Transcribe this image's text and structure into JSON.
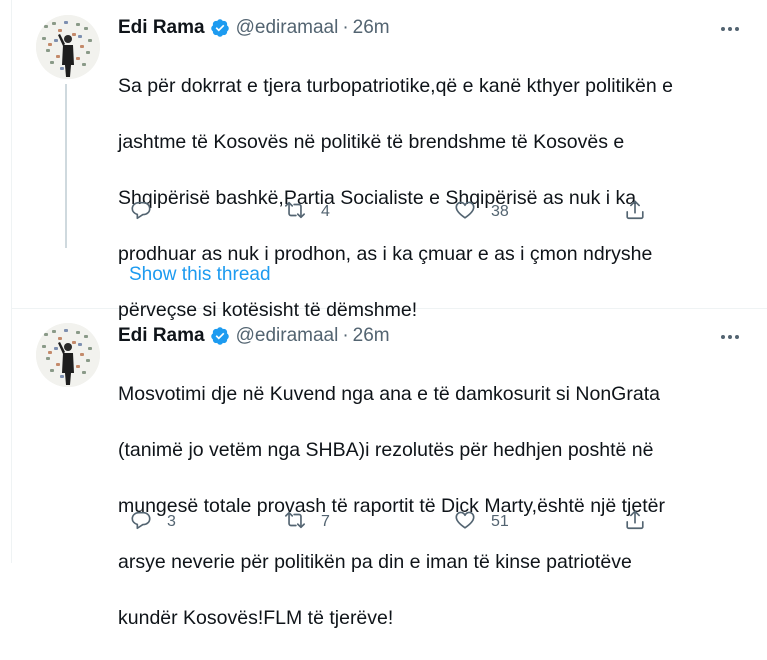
{
  "colors": {
    "accent": "#1d9bf0",
    "secondary_text": "#536471",
    "primary_text": "#0f1419",
    "divider": "#eff3f4"
  },
  "tweets": [
    {
      "author_name": "Edi Rama",
      "handle": "@ediramaal",
      "separator": "·",
      "time": "26m",
      "verified_icon": "verified-badge-icon",
      "text_lines": [
        "Sa për dokrrat e tjera turbopatriotike,që e kanë kthyer politikën e",
        "jashtme të Kosovës në politikë të brendshme të Kosovës e",
        "Shqipërisë bashkë,Partia Socialiste e Shqipërisë as nuk i ka",
        "prodhuar as nuk i prodhon, as i ka çmuar e as i çmon ndryshe",
        "përveçse si kotësisht të dëmshme!"
      ],
      "reply_count": "",
      "retweet_count": "4",
      "like_count": "38",
      "show_thread": "Show this thread"
    },
    {
      "author_name": "Edi Rama",
      "handle": "@ediramaal",
      "separator": "·",
      "time": "26m",
      "verified_icon": "verified-badge-icon",
      "text_lines": [
        "Mosvotimi dje në Kuvend nga ana e të damkosurit si NonGrata",
        "(tanimë jo vetëm nga SHBA)i rezolutës për hedhjen poshtë në",
        "mungesë totale provash të raportit të Dick Marty,është një tjetër",
        "arsye neverie për politikën pa din e iman të kinse patriotëve",
        "kundër Kosovës!FLM të tjerëve!"
      ],
      "reply_count": "3",
      "retweet_count": "7",
      "like_count": "51"
    }
  ]
}
